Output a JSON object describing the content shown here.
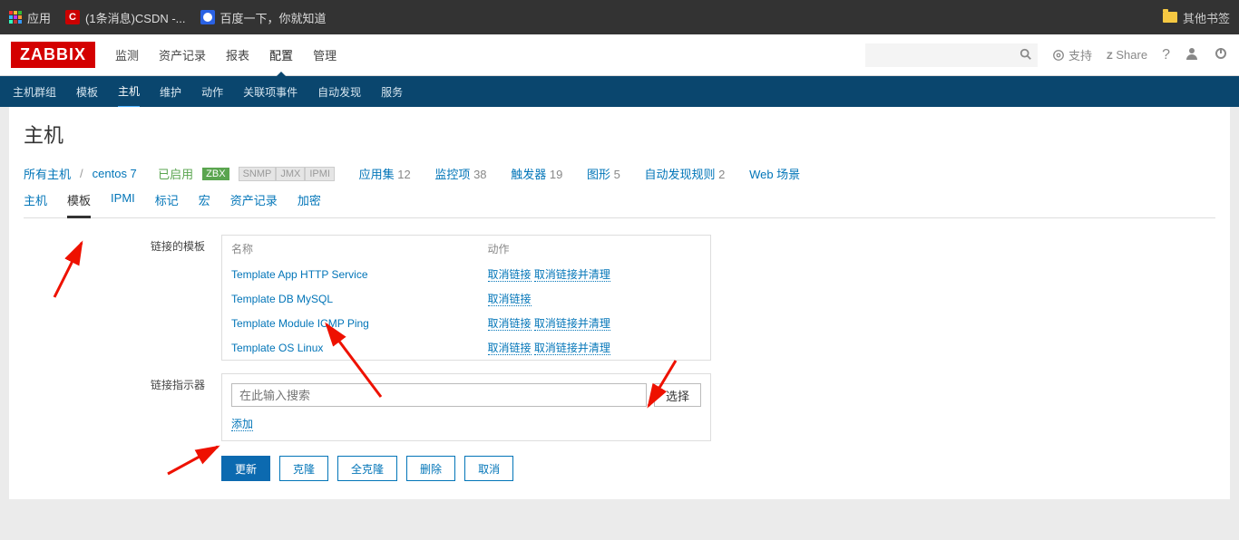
{
  "browser": {
    "apps": "应用",
    "csdn": "(1条消息)CSDN -...",
    "baidu": "百度一下，你就知道",
    "other_bookmarks": "其他书签"
  },
  "header": {
    "logo": "ZABBIX",
    "nav": [
      "监测",
      "资产记录",
      "报表",
      "配置",
      "管理"
    ],
    "nav_active_index": 3,
    "support": "支持",
    "share": "Share"
  },
  "subnav": {
    "items": [
      "主机群组",
      "模板",
      "主机",
      "维护",
      "动作",
      "关联项事件",
      "自动发现",
      "服务"
    ],
    "active_index": 2
  },
  "page_title": "主机",
  "breadcrumb": {
    "all_hosts": "所有主机",
    "host": "centos 7",
    "enabled": "已启用",
    "zbx": "ZBX",
    "snmp": "SNMP",
    "jmx": "JMX",
    "ipmi": "IPMI",
    "links": [
      {
        "label": "应用集",
        "count": "12"
      },
      {
        "label": "监控项",
        "count": "38"
      },
      {
        "label": "触发器",
        "count": "19"
      },
      {
        "label": "图形",
        "count": "5"
      },
      {
        "label": "自动发现规则",
        "count": "2"
      },
      {
        "label": "Web 场景",
        "count": ""
      }
    ]
  },
  "innertabs": {
    "items": [
      "主机",
      "模板",
      "IPMI",
      "标记",
      "宏",
      "资产记录",
      "加密"
    ],
    "active_index": 1
  },
  "form": {
    "linked_label": "链接的模板",
    "indicator_label": "链接指示器",
    "th_name": "名称",
    "th_action": "动作",
    "templates": [
      {
        "name": "Template App HTTP Service",
        "unlink": "取消链接",
        "clear": "取消链接并清理"
      },
      {
        "name": "Template DB MySQL",
        "unlink": "取消链接",
        "clear": ""
      },
      {
        "name": "Template Module ICMP Ping",
        "unlink": "取消链接",
        "clear": "取消链接并清理"
      },
      {
        "name": "Template OS Linux",
        "unlink": "取消链接",
        "clear": "取消链接并清理"
      }
    ],
    "search_placeholder": "在此输入搜索",
    "select_btn": "选择",
    "add_link": "添加"
  },
  "actions": {
    "update": "更新",
    "clone": "克隆",
    "full_clone": "全克隆",
    "delete": "删除",
    "cancel": "取消"
  }
}
